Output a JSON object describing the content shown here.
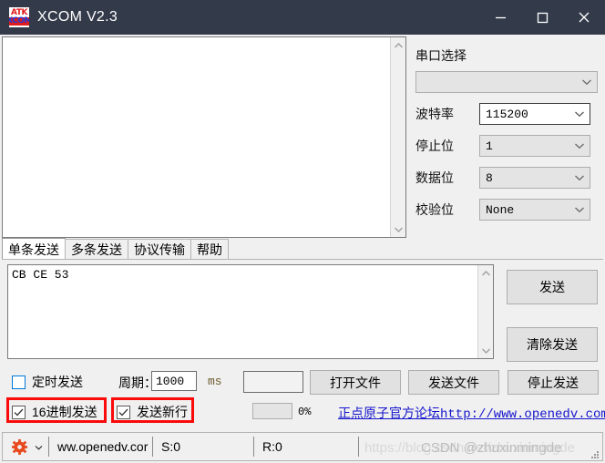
{
  "window": {
    "title": "XCOM V2.3",
    "logo_top": "ATK",
    "logo_bottom": "XCOM",
    "minimize_label": "minimize",
    "maximize_label": "maximize",
    "close_label": "close"
  },
  "receive": {
    "text": "",
    "scroll_up": "scroll-up",
    "scroll_down": "scroll-down"
  },
  "serial_panel": {
    "title": "串口选择",
    "port_value": "",
    "fields": [
      {
        "label": "波特率",
        "value": "115200",
        "state": "active"
      },
      {
        "label": "停止位",
        "value": "1",
        "state": "disabled"
      },
      {
        "label": "数据位",
        "value": "8",
        "state": "disabled"
      },
      {
        "label": "校验位",
        "value": "None",
        "state": "disabled"
      }
    ]
  },
  "tabs": [
    {
      "label": "单条发送",
      "active": true
    },
    {
      "label": "多条发送",
      "active": false
    },
    {
      "label": "协议传输",
      "active": false
    },
    {
      "label": "帮助",
      "active": false
    }
  ],
  "send": {
    "text": "CB CE 53",
    "send_button": "发送",
    "clear_button": "清除发送"
  },
  "options": {
    "timed_send_label": "定时发送",
    "timed_send_checked": false,
    "period_label": "周期：",
    "period_value": "1000",
    "ms_label": "ms",
    "extra_value": "",
    "hex_send_label": "16进制发送",
    "hex_send_checked": true,
    "new_line_label": "发送新行",
    "new_line_checked": true,
    "check_mark": "✓"
  },
  "file_buttons": {
    "open_file": "打开文件",
    "send_file": "发送文件",
    "stop_send": "停止发送"
  },
  "progress": {
    "percent_label": "0%",
    "value": 0
  },
  "link": {
    "text": "正点原子官方论坛http://www.openedv.com/"
  },
  "statusbar": {
    "url": "ww.openedv.cor",
    "sent": "S:0",
    "received": "R:0"
  },
  "watermark": {
    "faint": "https://blog.csdn.net/zhuxinmingde",
    "strong": "CSDN @zhuxinmingde"
  },
  "colors": {
    "titlebar": "#333b4a",
    "accent_red": "#fa0a0a",
    "link_blue": "#1515cd",
    "gear_orange": "#e8491d"
  }
}
